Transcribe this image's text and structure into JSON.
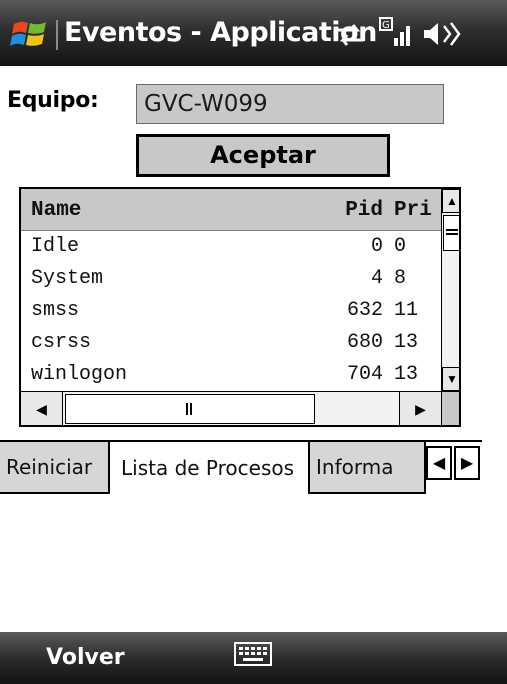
{
  "titlebar": {
    "title": "Eventos - Application",
    "icons": [
      "windows-start-icon",
      "sync-arrows-icon",
      "signal-strength-icon",
      "volume-icon"
    ]
  },
  "form": {
    "equipo_label": "Equipo:",
    "equipo_value": "GVC-W099",
    "aceptar_label": "Aceptar"
  },
  "list": {
    "headers": {
      "name": "Name",
      "pid": "Pid",
      "pri": "Pri"
    },
    "rows": [
      {
        "name": "Idle",
        "pid": "0",
        "pri": "0"
      },
      {
        "name": "System",
        "pid": "4",
        "pri": "8"
      },
      {
        "name": "smss",
        "pid": "632",
        "pri": "11"
      },
      {
        "name": "csrss",
        "pid": "680",
        "pri": "13"
      },
      {
        "name": "winlogon",
        "pid": "704",
        "pri": "13"
      }
    ]
  },
  "tabs": {
    "reiniciar": "Reiniciar",
    "lista": "Lista de Procesos",
    "info": "Informa"
  },
  "softkeys": {
    "left": "Volver"
  },
  "colors": {
    "titlebar": "#2e2e2e",
    "field_bg": "#c8c8c8",
    "tab_inactive": "#d6d6d6"
  }
}
